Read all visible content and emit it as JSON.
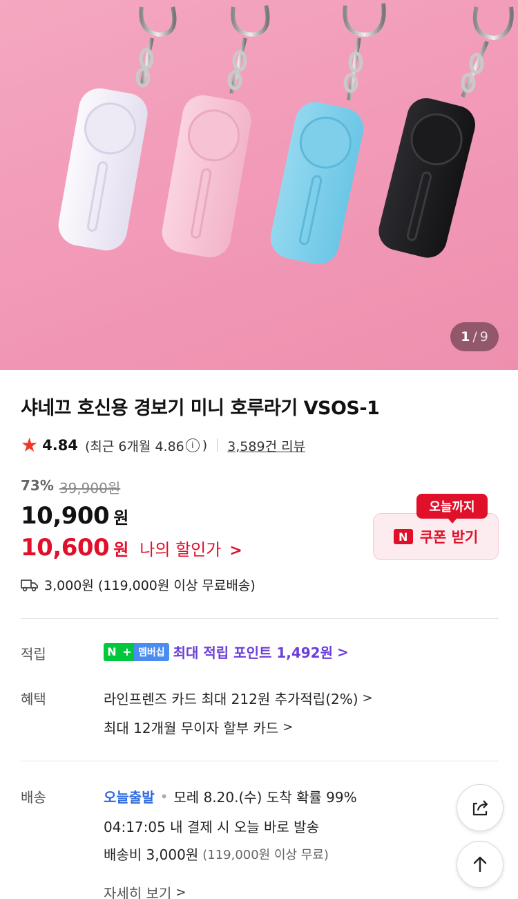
{
  "gallery": {
    "current": "1",
    "separator": "/",
    "total": "9"
  },
  "product": {
    "title": "샤네끄 호신용 경보기 미니 호루라기 VSOS-1",
    "rating": "4.84",
    "recent_rating": "(최근 6개월 4.86",
    "recent_close": ")",
    "reviews": "3,589건 리뷰"
  },
  "price": {
    "discount": "73%",
    "original": "39,900원",
    "sale": "10,900",
    "sale_unit": "원",
    "my_price": "10,600",
    "my_price_unit": "원",
    "my_price_label": "나의 할인가"
  },
  "coupon": {
    "tag": "오늘까지",
    "badge": "N",
    "label": "쿠폰 받기"
  },
  "shipping": {
    "text": "3,000원 (119,000원 이상 무료배송)"
  },
  "benefits": {
    "points_label": "적립",
    "npay_n": "N",
    "npay_plus": "+",
    "npay_member": "멤버십",
    "points_text": "최대 적립 포인트 1,492원",
    "perks_label": "혜택",
    "perk1": "라인프렌즈 카드 최대 212원 추가적립(2%)",
    "perk2": "최대 12개월 무이자 할부 카드"
  },
  "delivery": {
    "label": "배송",
    "badge": "오늘출발",
    "arrival": "모레 8.20.(수) 도착 확률 99%",
    "deadline": "04:17:05  내 결제 시 오늘 바로 발송",
    "fee": "배송비 3,000원",
    "fee_note": "(119,000원 이상 무료)",
    "more": "자세히 보기"
  },
  "colors": {
    "accent_red": "#e0102a",
    "point_purple": "#6a3ed8",
    "npay_green": "#00c73c",
    "delivery_blue": "#2f6bde",
    "hero_pink": "#f29bb9"
  }
}
